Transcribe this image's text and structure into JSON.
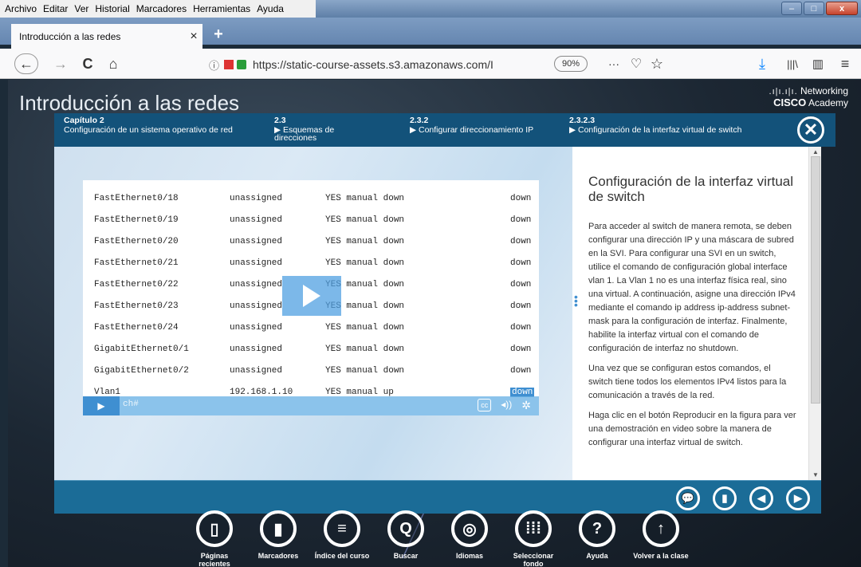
{
  "menubar": {
    "items": [
      "Archivo",
      "Editar",
      "Ver",
      "Historial",
      "Marcadores",
      "Herramientas",
      "Ayuda"
    ]
  },
  "window_controls": {
    "minimize": "‒",
    "maximize": "□",
    "close": "x"
  },
  "tab": {
    "title": "Introducción a las redes",
    "close": "×",
    "new_tab": "+"
  },
  "navbar": {
    "url": "https://static-course-assets.s3.amazonaws.com/I",
    "zoom": "90%",
    "back": "←",
    "forward": "→",
    "reload": "C",
    "home": "⌂",
    "more": "···",
    "pocket": "♡",
    "bookmark": "☆",
    "download": "⤓",
    "library": "|||\\",
    "sidebar": "▥",
    "menu": "≡",
    "info": "ⓘ",
    "lock": "🔒"
  },
  "course": {
    "title": "Introducción a las redes",
    "brand_dots": ".ı|ı.ı|ı.",
    "brand_top": "Networking",
    "brand_cisco": "CISCO",
    "brand_academy": "Academy"
  },
  "breadcrumb": [
    {
      "num": "Capítulo 2",
      "label": "Configuración de un sistema operativo de red"
    },
    {
      "num": "2.3",
      "label": "Esquemas de direcciones"
    },
    {
      "num": "2.3.2",
      "label": "Configurar direccionamiento IP"
    },
    {
      "num": "2.3.2.3",
      "label": "Configuración de la interfaz virtual de switch"
    }
  ],
  "breadcrumb_close": "✕",
  "terminal_rows": [
    [
      "FastEthernet0/18",
      "unassigned",
      "YES manual down",
      "down"
    ],
    [
      "FastEthernet0/19",
      "unassigned",
      "YES manual down",
      "down"
    ],
    [
      "FastEthernet0/20",
      "unassigned",
      "YES manual down",
      "down"
    ],
    [
      "FastEthernet0/21",
      "unassigned",
      "YES manual down",
      "down"
    ],
    [
      "FastEthernet0/22",
      "unassigned",
      "YES manual down",
      "down"
    ],
    [
      "FastEthernet0/23",
      "unassigned",
      "YES manual down",
      "down"
    ],
    [
      "FastEthernet0/24",
      "unassigned",
      "YES manual down",
      "down"
    ],
    [
      "GigabitEthernet0/1",
      "unassigned",
      "YES manual down",
      "down"
    ],
    [
      "GigabitEthernet0/2",
      "unassigned",
      "YES manual down",
      "down"
    ],
    [
      "Vlan1",
      "192.168.1.10",
      "YES manual up",
      "down"
    ]
  ],
  "video": {
    "prompt": "ch#",
    "cc": "cc",
    "volume": "◂))",
    "settings": "✲",
    "play": "▶"
  },
  "article": {
    "title": "Configuración de la interfaz virtual de switch",
    "p1": "Para acceder al switch de manera remota, se deben configurar una dirección IP y una máscara de subred en la SVI. Para configurar una SVI en un switch, utilice el comando de configuración global interface vlan 1. La Vlan 1 no es una interfaz física real, sino una virtual. A continuación, asigne una dirección IPv4 mediante el comando ip address ip-address subnet-mask para la configuración de interfaz. Finalmente, habilite la interfaz virtual con el comando de configuración de interfaz no shutdown.",
    "p2": "Una vez que se configuran estos comandos, el switch tiene todos los elementos IPv4 listos para la comunicación a través de la red.",
    "p3": "Haga clic en el botón Reproducir en la figura para ver una demostración en video sobre la manera de configurar una interfaz virtual de switch."
  },
  "bottom_bar": {
    "chat": "💬",
    "bookmark": "▮",
    "prev": "◀",
    "next": "▶"
  },
  "dock": [
    {
      "icon": "▯",
      "label": "Páginas recientes",
      "name": "recent-pages"
    },
    {
      "icon": "▮",
      "label": "Marcadores",
      "name": "bookmarks"
    },
    {
      "icon": "≡",
      "label": "Índice del curso",
      "name": "course-index"
    },
    {
      "icon": "Q",
      "label": "Buscar",
      "name": "search"
    },
    {
      "icon": "◎",
      "label": "Idiomas",
      "name": "languages"
    },
    {
      "icon": "⁞⁞⁞",
      "label": "Seleccionar fondo",
      "name": "select-background"
    },
    {
      "icon": "?",
      "label": "Ayuda",
      "name": "help"
    },
    {
      "icon": "↑",
      "label": "Volver a la clase",
      "name": "back-to-class"
    }
  ]
}
